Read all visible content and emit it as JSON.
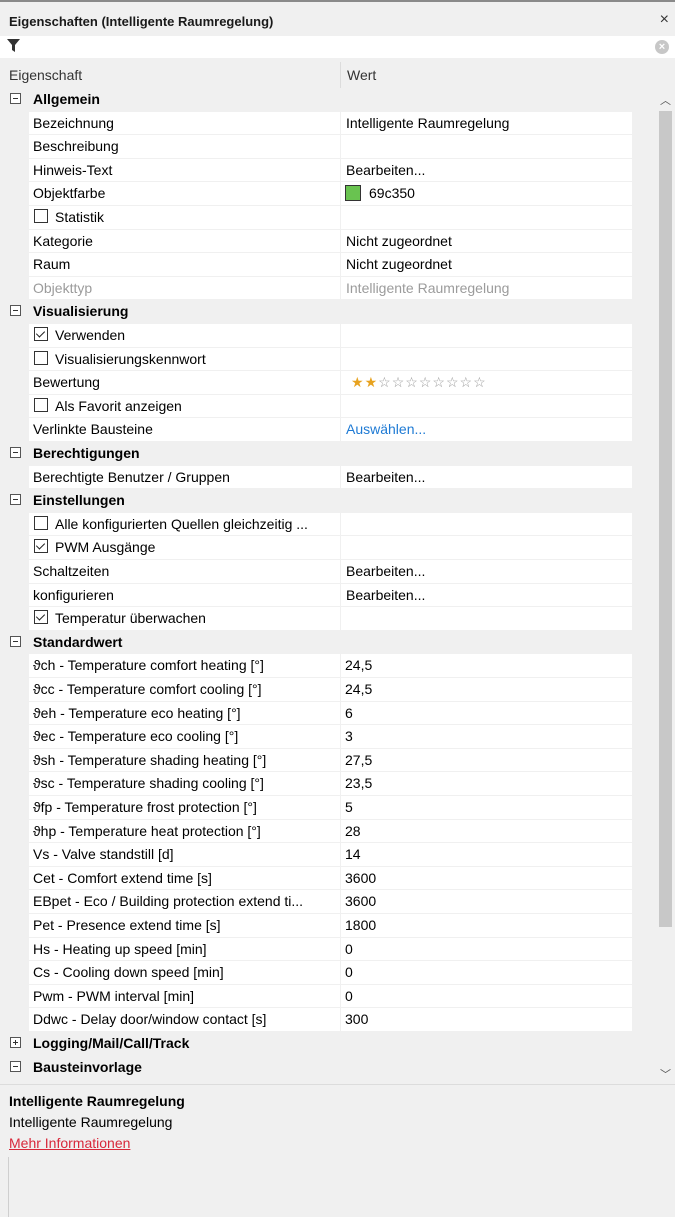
{
  "panel": {
    "title": "Eigenschaften (Intelligente Raumregelung)",
    "close": "×"
  },
  "filter": {
    "placeholder": "",
    "clear": "×"
  },
  "headers": {
    "property": "Eigenschaft",
    "value": "Wert"
  },
  "colors": {
    "object_color": "#69c350",
    "link": "#1e7ad4",
    "more_info": "#d8283a"
  },
  "rows": [
    {
      "kind": "cat",
      "label": "Allgemein",
      "expanded": true
    },
    {
      "kind": "prop",
      "name": "Bezeichnung",
      "value": "Intelligente Raumregelung"
    },
    {
      "kind": "prop",
      "name": "Beschreibung",
      "value": ""
    },
    {
      "kind": "prop",
      "name": "Hinweis-Text",
      "value": "Bearbeiten..."
    },
    {
      "kind": "color",
      "name": "Objektfarbe",
      "value": "69c350"
    },
    {
      "kind": "check",
      "name": "Statistik",
      "checked": false
    },
    {
      "kind": "prop",
      "name": "Kategorie",
      "value": "Nicht zugeordnet"
    },
    {
      "kind": "prop",
      "name": "Raum",
      "value": "Nicht zugeordnet"
    },
    {
      "kind": "prop",
      "name": "Objekttyp",
      "value": "Intelligente Raumregelung",
      "disabled": true
    },
    {
      "kind": "cat",
      "label": "Visualisierung",
      "expanded": true
    },
    {
      "kind": "check",
      "name": "Verwenden",
      "checked": true
    },
    {
      "kind": "check",
      "name": "Visualisierungskennwort",
      "checked": false
    },
    {
      "kind": "rating",
      "name": "Bewertung",
      "rating": 2,
      "max": 10
    },
    {
      "kind": "check",
      "name": "Als Favorit anzeigen",
      "checked": false
    },
    {
      "kind": "prop",
      "name": "Verlinkte Bausteine",
      "value": "Auswählen...",
      "link": true
    },
    {
      "kind": "cat",
      "label": "Berechtigungen",
      "expanded": true
    },
    {
      "kind": "prop",
      "name": "Berechtigte Benutzer / Gruppen",
      "value": "Bearbeiten..."
    },
    {
      "kind": "cat",
      "label": "Einstellungen",
      "expanded": true
    },
    {
      "kind": "check",
      "name": "Alle konfigurierten Quellen gleichzeitig ...",
      "checked": false
    },
    {
      "kind": "check",
      "name": "PWM Ausgänge",
      "checked": true
    },
    {
      "kind": "prop",
      "name": "Schaltzeiten",
      "value": "Bearbeiten..."
    },
    {
      "kind": "prop",
      "name": "konfigurieren",
      "value": "Bearbeiten..."
    },
    {
      "kind": "check",
      "name": "Temperatur überwachen",
      "checked": true
    },
    {
      "kind": "cat",
      "label": "Standardwert",
      "expanded": true
    },
    {
      "kind": "prop",
      "sv": true,
      "name": "ϑch - Temperature comfort heating [°]",
      "value": "24,5"
    },
    {
      "kind": "prop",
      "sv": true,
      "name": "ϑcc - Temperature comfort cooling [°]",
      "value": "24,5"
    },
    {
      "kind": "prop",
      "sv": true,
      "name": "ϑeh - Temperature eco heating [°]",
      "value": "6"
    },
    {
      "kind": "prop",
      "sv": true,
      "name": "ϑec - Temperature eco cooling [°]",
      "value": "3"
    },
    {
      "kind": "prop",
      "sv": true,
      "name": "ϑsh - Temperature shading heating [°]",
      "value": "27,5"
    },
    {
      "kind": "prop",
      "sv": true,
      "name": "ϑsc - Temperature shading cooling [°]",
      "value": "23,5"
    },
    {
      "kind": "prop",
      "sv": true,
      "name": "ϑfp - Temperature frost protection [°]",
      "value": "5"
    },
    {
      "kind": "prop",
      "sv": true,
      "name": "ϑhp - Temperature heat protection [°]",
      "value": "28"
    },
    {
      "kind": "prop",
      "sv": true,
      "name": "Vs - Valve standstill [d]",
      "value": "14"
    },
    {
      "kind": "prop",
      "sv": true,
      "name": "Cet - Comfort extend time [s]",
      "value": "3600"
    },
    {
      "kind": "prop",
      "sv": true,
      "name": "EBpet - Eco / Building protection extend ti...",
      "value": "3600"
    },
    {
      "kind": "prop",
      "sv": true,
      "name": "Pet - Presence extend time [s]",
      "value": "1800"
    },
    {
      "kind": "prop",
      "sv": true,
      "name": "Hs - Heating up speed [min]",
      "value": "0"
    },
    {
      "kind": "prop",
      "sv": true,
      "name": "Cs - Cooling down speed [min]",
      "value": "0"
    },
    {
      "kind": "prop",
      "sv": true,
      "name": "Pwm - PWM interval [min]",
      "value": "0"
    },
    {
      "kind": "prop",
      "sv": true,
      "name": "Ddwc - Delay door/window contact [s]",
      "value": "300"
    },
    {
      "kind": "cat",
      "label": "Logging/Mail/Call/Track",
      "expanded": false
    },
    {
      "kind": "cat",
      "label": "Bausteinvorlage",
      "expanded": true
    }
  ],
  "description": {
    "title": "Intelligente Raumregelung",
    "text": "Intelligente Raumregelung",
    "link": "Mehr Informationen"
  }
}
